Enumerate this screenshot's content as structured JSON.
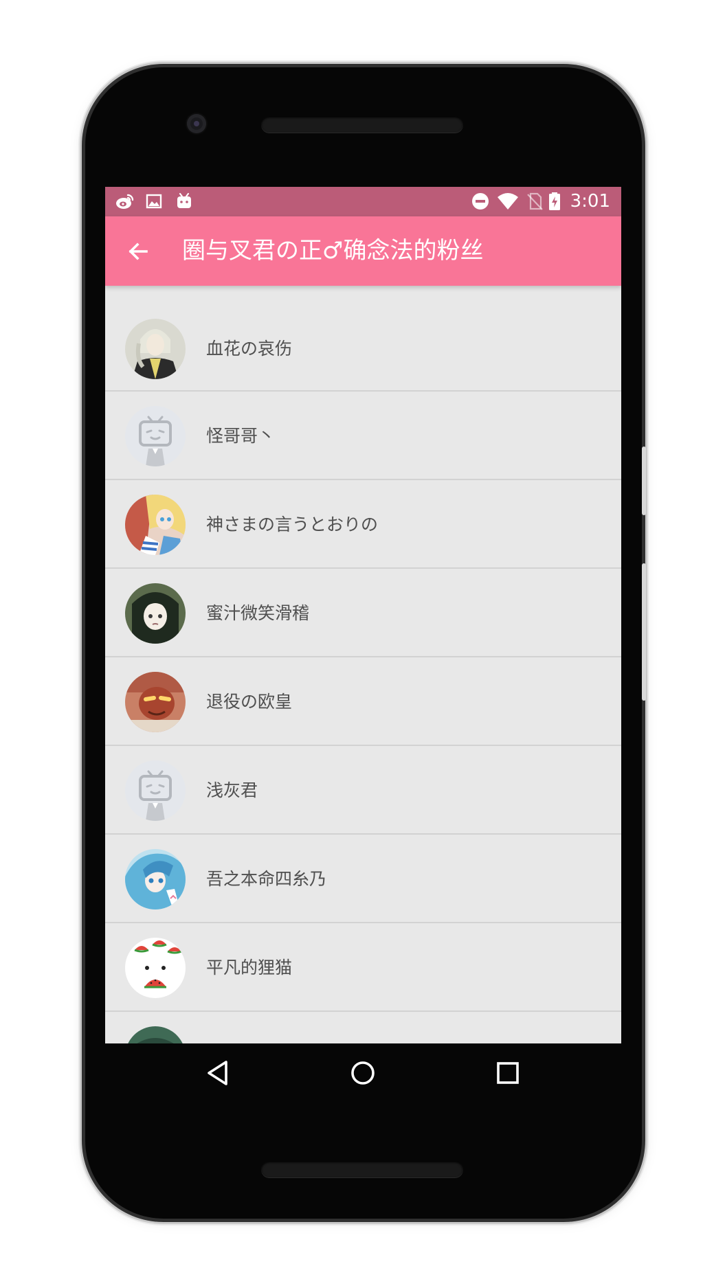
{
  "status_bar": {
    "time": "3:01",
    "left_icons": [
      "weibo-icon",
      "image-icon",
      "bilibili-tv-icon"
    ],
    "right_icons": [
      "do-not-disturb-icon",
      "wifi-icon",
      "no-sim-icon",
      "battery-charging-icon"
    ]
  },
  "toolbar": {
    "title": "圈与叉君の正♂确念法的粉丝",
    "back_icon": "arrow-back-icon",
    "color": "#f97597"
  },
  "status_bar_color": "#bb5c78",
  "followers": [
    {
      "name": "血花の哀伤",
      "avatar": "anime-boy-avatar"
    },
    {
      "name": "怪哥哥丶",
      "avatar": "default-tv-avatar"
    },
    {
      "name": "神さまの言うとおりの",
      "avatar": "anime-girls-avatar"
    },
    {
      "name": "蜜汁微笑滑稽",
      "avatar": "dark-hair-girl-avatar"
    },
    {
      "name": "退役の欧皇",
      "avatar": "red-face-avatar"
    },
    {
      "name": "浅灰君",
      "avatar": "default-tv-avatar"
    },
    {
      "name": "吾之本命四糸乃",
      "avatar": "yoshino-avatar"
    },
    {
      "name": "平凡的狸猫",
      "avatar": "watermelon-cat-avatar"
    },
    {
      "name": "",
      "avatar": "partial-avatar"
    }
  ],
  "nav": {
    "back": "nav-back-icon",
    "home": "nav-home-icon",
    "recents": "nav-recents-icon"
  }
}
